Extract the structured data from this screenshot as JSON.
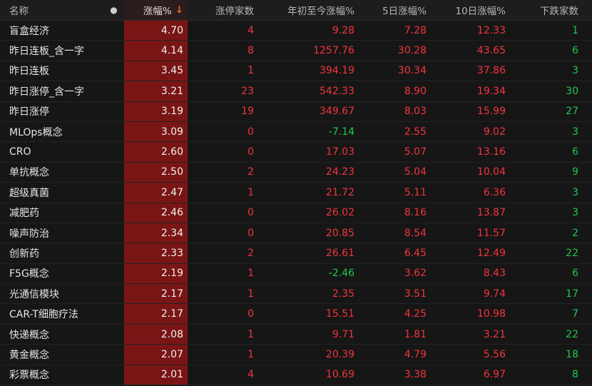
{
  "header": {
    "name": "名称",
    "dot": "●",
    "change": "涨幅%",
    "change_sort": "↓",
    "limit_up_count": "涨停家数",
    "ytd": "年初至今涨幅%",
    "d5": "5日涨幅%",
    "d10": "10日涨幅%",
    "down_count": "下跌家数"
  },
  "rows": [
    {
      "name": "盲盒经济",
      "change": "4.70",
      "zt": "4",
      "ytd": "9.28",
      "d5": "7.28",
      "d10": "12.33",
      "down": "1",
      "ytd_color": "red"
    },
    {
      "name": "昨日连板_含一字",
      "change": "4.14",
      "zt": "8",
      "ytd": "1257.76",
      "d5": "30.28",
      "d10": "43.65",
      "down": "6",
      "ytd_color": "red"
    },
    {
      "name": "昨日连板",
      "change": "3.45",
      "zt": "1",
      "ytd": "394.19",
      "d5": "30.34",
      "d10": "37.86",
      "down": "3",
      "ytd_color": "red"
    },
    {
      "name": "昨日涨停_含一字",
      "change": "3.21",
      "zt": "23",
      "ytd": "542.33",
      "d5": "8.90",
      "d10": "19.34",
      "down": "30",
      "ytd_color": "red"
    },
    {
      "name": "昨日涨停",
      "change": "3.19",
      "zt": "19",
      "ytd": "349.67",
      "d5": "8.03",
      "d10": "15.99",
      "down": "27",
      "ytd_color": "red"
    },
    {
      "name": "MLOps概念",
      "change": "3.09",
      "zt": "0",
      "ytd": "-7.14",
      "d5": "2.55",
      "d10": "9.02",
      "down": "3",
      "ytd_color": "green"
    },
    {
      "name": "CRO",
      "change": "2.60",
      "zt": "0",
      "ytd": "17.03",
      "d5": "5.07",
      "d10": "13.16",
      "down": "6",
      "ytd_color": "red"
    },
    {
      "name": "单抗概念",
      "change": "2.50",
      "zt": "2",
      "ytd": "24.23",
      "d5": "5.04",
      "d10": "10.04",
      "down": "9",
      "ytd_color": "red"
    },
    {
      "name": "超级真菌",
      "change": "2.47",
      "zt": "1",
      "ytd": "21.72",
      "d5": "5.11",
      "d10": "6.36",
      "down": "3",
      "ytd_color": "red"
    },
    {
      "name": "减肥药",
      "change": "2.46",
      "zt": "0",
      "ytd": "26.02",
      "d5": "8.16",
      "d10": "13.87",
      "down": "3",
      "ytd_color": "red"
    },
    {
      "name": "噪声防治",
      "change": "2.34",
      "zt": "0",
      "ytd": "20.85",
      "d5": "8.54",
      "d10": "11.57",
      "down": "2",
      "ytd_color": "red"
    },
    {
      "name": "创新药",
      "change": "2.33",
      "zt": "2",
      "ytd": "26.61",
      "d5": "6.45",
      "d10": "12.49",
      "down": "22",
      "ytd_color": "red"
    },
    {
      "name": "F5G概念",
      "change": "2.19",
      "zt": "1",
      "ytd": "-2.46",
      "d5": "3.62",
      "d10": "8.43",
      "down": "6",
      "ytd_color": "green"
    },
    {
      "name": "光通信模块",
      "change": "2.17",
      "zt": "1",
      "ytd": "2.35",
      "d5": "3.51",
      "d10": "9.74",
      "down": "17",
      "ytd_color": "red"
    },
    {
      "name": "CAR-T细胞疗法",
      "change": "2.17",
      "zt": "0",
      "ytd": "15.51",
      "d5": "4.25",
      "d10": "10.98",
      "down": "7",
      "ytd_color": "red"
    },
    {
      "name": "快递概念",
      "change": "2.08",
      "zt": "1",
      "ytd": "9.71",
      "d5": "1.81",
      "d10": "3.21",
      "down": "22",
      "ytd_color": "red"
    },
    {
      "name": "黄金概念",
      "change": "2.07",
      "zt": "1",
      "ytd": "20.39",
      "d5": "4.79",
      "d10": "5.56",
      "down": "18",
      "ytd_color": "red"
    },
    {
      "name": "彩票概念",
      "change": "2.01",
      "zt": "4",
      "ytd": "10.69",
      "d5": "3.38",
      "d10": "6.97",
      "down": "8",
      "ytd_color": "red"
    }
  ]
}
